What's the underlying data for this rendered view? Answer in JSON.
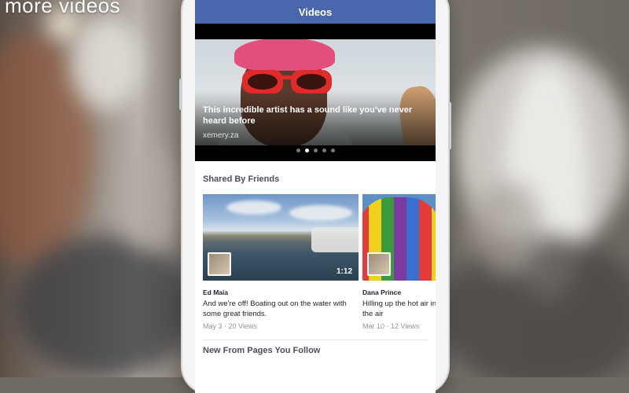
{
  "overlay_caption": "more videos",
  "app": {
    "title": "Videos"
  },
  "hero": {
    "title": "This incredible artist has a sound like you've never heard before",
    "source": "xemery.za",
    "dots_count": 5,
    "active_dot": 1
  },
  "sections": {
    "shared_by_friends": "Shared By Friends",
    "new_from_pages": "New From Pages You Follow"
  },
  "shared_videos": [
    {
      "poster": "Ed Maia",
      "description": "And we're off! Boating out on the water with some great friends.",
      "meta": "May 3 · 20 Views",
      "duration": "1:12"
    },
    {
      "poster": "Dana Prince",
      "description": "Hilling up the hot air in the air",
      "meta": "Mar 10 · 12 Views",
      "duration": ""
    }
  ],
  "colors": {
    "header": "#4a67ad",
    "screen": "#ffffff"
  }
}
